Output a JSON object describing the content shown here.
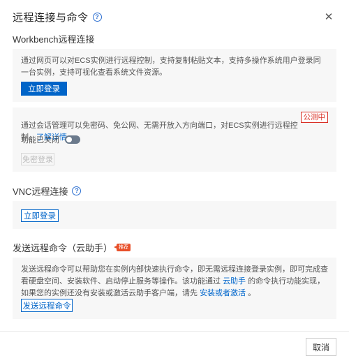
{
  "dialog": {
    "title": "远程连接与命令",
    "help_icon": "?",
    "close_icon": "✕"
  },
  "workbench": {
    "title": "Workbench远程连接",
    "desc": "通过网页可以对ECS实例进行远程控制，支持复制粘贴文本，支持多操作系统用户登录同一台实例，支持可视化查看系统文件资源。",
    "login_button": "立即登录"
  },
  "session": {
    "badge": "公测中",
    "desc_prefix": "通过会话管理可以免密码、免公网、无需开放入方向端口，对ECS实例进行远程控制。",
    "desc_link": "了解详情。",
    "toggle_label": "功能已关闭",
    "toggle_on": false,
    "free_login_button": "免密登录"
  },
  "vnc": {
    "title": "VNC远程连接",
    "help_icon": "?",
    "login_button": "立即登录"
  },
  "cloud_assistant": {
    "title": "发送远程命令（云助手）",
    "badge": "推荐",
    "desc_part1": "发送远程命令可以帮助您在实例内部快速执行命令，即无需远程连接登录实例，即可完成查看硬盘空间、安装软件、启动停止服务等操作。该功能通过",
    "desc_link1": "云助手",
    "desc_part2": "的命令执行功能实现，如果您的实例还没有安装或激活云助手客户端，请先",
    "desc_link2": "安装或者激活",
    "desc_part3": "。",
    "send_button": "发送远程命令"
  },
  "footer": {
    "cancel_button": "取消"
  }
}
